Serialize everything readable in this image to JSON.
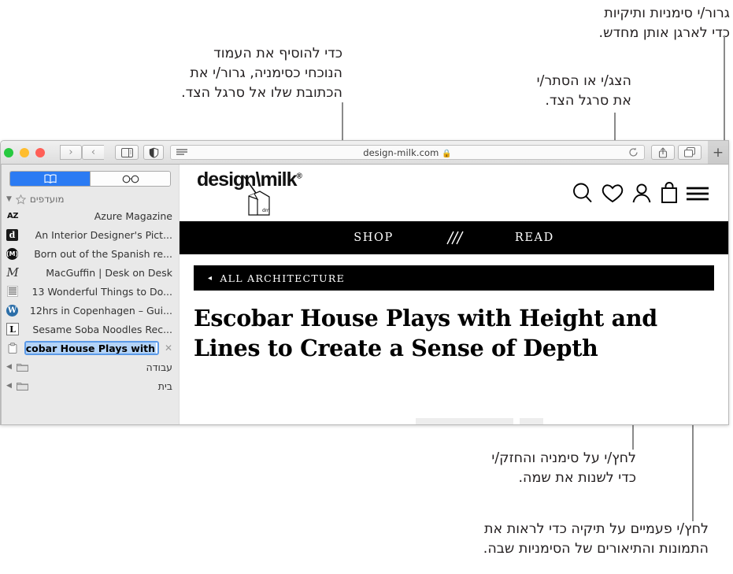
{
  "annotations": [
    {
      "id": "add-bookmark",
      "text": "כדי להוסיף את העמוד\nהנוכחי כסימניה, גרור/י את\nהכתובת שלו אל סרגל הצד."
    },
    {
      "id": "reorder",
      "text": "גרור/י סימניות ותיקיות\nכדי לארגן אותן מחדש."
    },
    {
      "id": "toggle-sidebar",
      "text": "הצג/י או הסתר/י\nאת סרגל הצד."
    },
    {
      "id": "rename",
      "text": "לחץ/י על סימניה והחזק/י\nכדי לשנות את שמה."
    },
    {
      "id": "open-folder",
      "text": "לחץ/י פעמיים על תיקיה כדי לראות את\nהתמונות והתיאורים של הסימניות שבה."
    }
  ],
  "toolbar": {
    "new_tab_label": "+",
    "url": "design-milk.com",
    "lock_icon": "lock-icon",
    "reload_icon": "reload-icon",
    "sidebar_toggle_icon": "sidebar-toggle-icon",
    "back_label": "‹",
    "forward_label": "›",
    "tabs_icon": "show-tabs-icon",
    "share_icon": "share-icon",
    "reader_icon": "reader-view-icon",
    "privacy_icon": "privacy-report-icon",
    "traffic_lights": [
      "close-button",
      "minimize-button",
      "zoom-button"
    ]
  },
  "sidebar": {
    "tabs": [
      {
        "id": "reading-list",
        "icon": "glasses-icon",
        "active": false
      },
      {
        "id": "bookmarks",
        "icon": "book-icon",
        "active": true
      }
    ],
    "section_title": "מועדפים",
    "section_star_icon": "star-icon",
    "section_disclosure_icon": "disclosure-triangle-down-icon",
    "bookmarks": [
      {
        "label": "Azure Magazine",
        "icon": "az",
        "rtl": false
      },
      {
        "label": "An Interior Designer's Pict...",
        "icon": "d",
        "rtl": false
      },
      {
        "label": "Born out of the Spanish re...",
        "icon": "m",
        "rtl": false
      },
      {
        "label": "MacGuffin | Desk on Desk",
        "icon": "mac",
        "rtl": false
      },
      {
        "label": "13 Wonderful Things to Do...",
        "icon": "grid",
        "rtl": false
      },
      {
        "label": "12hrs in Copenhagen – Gui...",
        "icon": "wp",
        "rtl": false
      },
      {
        "label": "Sesame Soba Noodles Rec...",
        "icon": "l",
        "rtl": false
      }
    ],
    "editing_bookmark": {
      "value": "Escobar House Plays with",
      "icon": "clipboard-icon",
      "close_label": "✕"
    },
    "folders": [
      {
        "label": "עבודה",
        "icon": "folder-icon",
        "disclosure": "◀"
      },
      {
        "label": "בית",
        "icon": "folder-icon",
        "disclosure": "◀"
      }
    ]
  },
  "webpage": {
    "logo_text": "design\\milk",
    "logo_reg_mark": "®",
    "logo_carton_text": "dm",
    "header_icons": [
      "search-icon",
      "heart-icon",
      "account-icon",
      "bag-icon",
      "menu-icon"
    ],
    "nav": [
      "SHOP",
      "READ"
    ],
    "nav_divider_icon": "slashes-icon",
    "breadcrumb_arrow": "◂",
    "breadcrumb": "ALL ARCHITECTURE",
    "headline": "Escobar House Plays with Height and Lines to Create a Sense of Depth"
  },
  "colors": {
    "accent_blue": "#2b7bf3",
    "selection_blue": "#b3d3f7",
    "sidebar_bg": "#e9e9e9",
    "nav_black": "#000000",
    "traffic_green": "#27c93f",
    "traffic_yellow": "#ffbd2e",
    "traffic_red": "#ff5f57"
  }
}
